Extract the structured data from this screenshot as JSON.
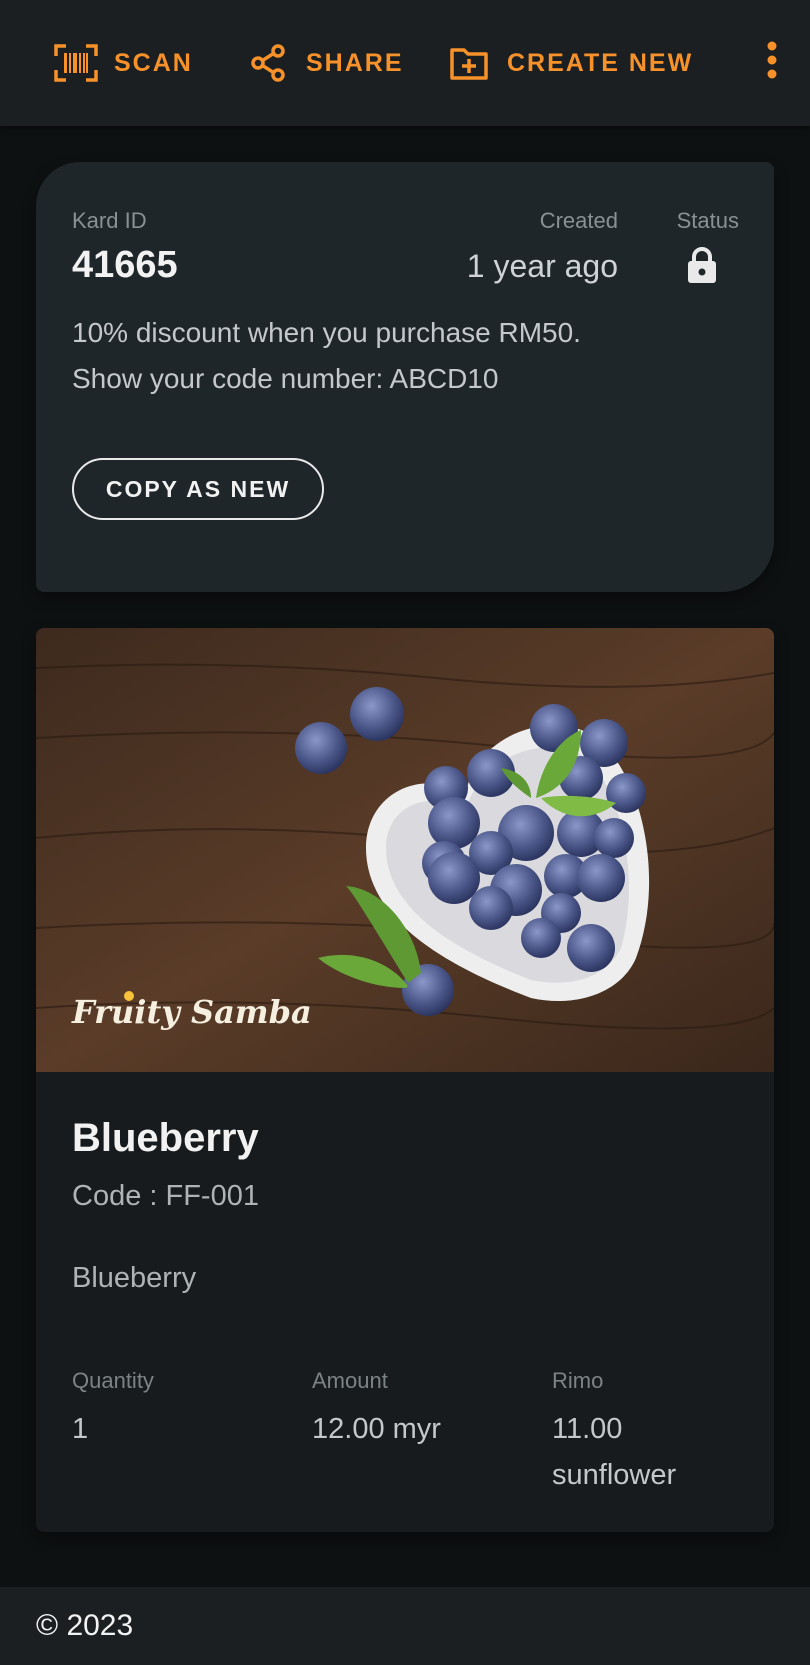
{
  "toolbar": {
    "scan_label": "SCAN",
    "share_label": "SHARE",
    "create_label": "CREATE NEW",
    "accent": "#f7922b"
  },
  "kard": {
    "id_label": "Kard ID",
    "id": "41665",
    "created_label": "Created",
    "created": "1 year ago",
    "status_label": "Status",
    "status_icon": "lock-icon",
    "description_line1": "10% discount when you purchase RM50.",
    "description_line2": "Show your code number: ABCD10",
    "copy_label": "COPY AS NEW"
  },
  "product": {
    "brand_text": "Fruity Samba",
    "title": "Blueberry",
    "code": "Code : FF-001",
    "description": "Blueberry",
    "quantity_label": "Quantity",
    "quantity": "1",
    "amount_label": "Amount",
    "amount": "12.00 myr",
    "rimo_label": "Rimo",
    "rimo": "11.00 sunflower"
  },
  "footer": {
    "copyright": "© 2023"
  }
}
